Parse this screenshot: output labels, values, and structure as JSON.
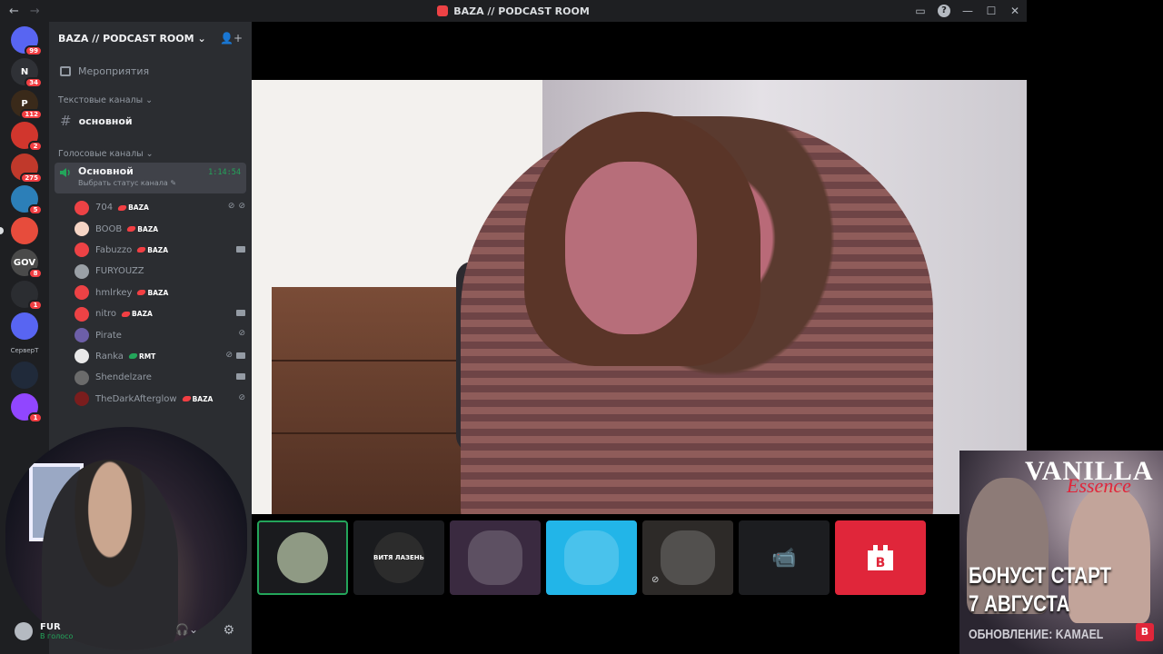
{
  "window": {
    "title": "BAZA // PODCAST ROOM"
  },
  "rail": {
    "servers": [
      {
        "label": "",
        "badge": "99",
        "color": "#5865f2"
      },
      {
        "label": "N",
        "badge": "34",
        "color": "#2f3136"
      },
      {
        "label": "P",
        "badge": "112",
        "color": "#3a2a1a"
      },
      {
        "label": "",
        "badge": "2",
        "color": "#d1362d"
      },
      {
        "label": "",
        "badge": "275",
        "color": "#c0392b"
      },
      {
        "label": "",
        "badge": "5",
        "color": "#2c7fb8"
      },
      {
        "label": "",
        "badge": "",
        "color": "#e74c3c"
      },
      {
        "label": "GOV",
        "badge": "8",
        "color": "#4a4a4a"
      },
      {
        "label": "",
        "badge": "1",
        "color": "#2b2d31"
      },
      {
        "label": "",
        "badge": "",
        "color": "#5865f2"
      }
    ],
    "text_server": "СерверТ",
    "more_servers": [
      {
        "label": "",
        "badge": "",
        "color": "#202a3a"
      },
      {
        "label": "",
        "badge": "1",
        "color": "#9146ff"
      }
    ]
  },
  "sidebar": {
    "guild_name": "BAZA // PODCAST ROOM",
    "events_label": "Мероприятия",
    "text_category": "Текстовые каналы",
    "text_channel": "основной",
    "voice_category": "Голосовые каналы",
    "voice_channel": {
      "name": "Основной",
      "status": "Выбрать статус канала",
      "timer": "1:14:54"
    },
    "members": [
      {
        "name": "704",
        "tag": "BAZA",
        "tag_color": "red",
        "avatar": "#ed4245",
        "icons": "⊘ ⊘"
      },
      {
        "name": "BOOB",
        "tag": "BAZA",
        "tag_color": "red",
        "avatar": "#f6d5c5",
        "icons": ""
      },
      {
        "name": "Fabuzzo",
        "tag": "BAZA",
        "tag_color": "red",
        "avatar": "#ed4245",
        "icons": "cam"
      },
      {
        "name": "FURYOUZZ",
        "tag": "",
        "tag_color": "",
        "avatar": "#9aa0a6",
        "icons": ""
      },
      {
        "name": "hmlrkey",
        "tag": "BAZA",
        "tag_color": "red",
        "avatar": "#ed4245",
        "icons": ""
      },
      {
        "name": "nitro",
        "tag": "BAZA",
        "tag_color": "red",
        "avatar": "#ed4245",
        "icons": "cam"
      },
      {
        "name": "Pirate",
        "tag": "",
        "tag_color": "",
        "avatar": "#6d5fa8",
        "icons": "⊘"
      },
      {
        "name": "Ranka",
        "tag": "RMT",
        "tag_color": "green",
        "avatar": "#e9e9e9",
        "icons": "⊘ cam"
      },
      {
        "name": "Shendelzare",
        "tag": "",
        "tag_color": "",
        "avatar": "#6b6b6b",
        "icons": "cam"
      },
      {
        "name": "TheDarkAfterglow",
        "tag": "BAZA",
        "tag_color": "red",
        "avatar": "#7a1d1d",
        "icons": "⊘"
      }
    ]
  },
  "user": {
    "name": "FUR",
    "status": "В голосо"
  },
  "tiles": [
    {
      "kind": "avatar",
      "color": "#8f9a84",
      "active": true,
      "label": ""
    },
    {
      "kind": "avatar",
      "color": "#2c2c2c",
      "active": false,
      "label": "ВИТЯ ЛАЗЕНЬ"
    },
    {
      "kind": "video",
      "color": "#3a2a40",
      "active": false,
      "label": ""
    },
    {
      "kind": "video",
      "color": "#22b5e8",
      "active": false,
      "label": ""
    },
    {
      "kind": "video",
      "color": "#2d2a28",
      "active": false,
      "label": ""
    },
    {
      "kind": "camera",
      "color": "#1c1d20",
      "active": false,
      "label": ""
    },
    {
      "kind": "brand",
      "color": "#e0263a",
      "active": false,
      "label": ""
    }
  ],
  "ad": {
    "brand_main": "VANILLA",
    "brand_script": "Essence",
    "line1": "БОНУСТ СТАРТ",
    "line2": "7 АВГУСТА",
    "line3": "ОБНОВЛЕНИЕ: KAMAEL"
  }
}
